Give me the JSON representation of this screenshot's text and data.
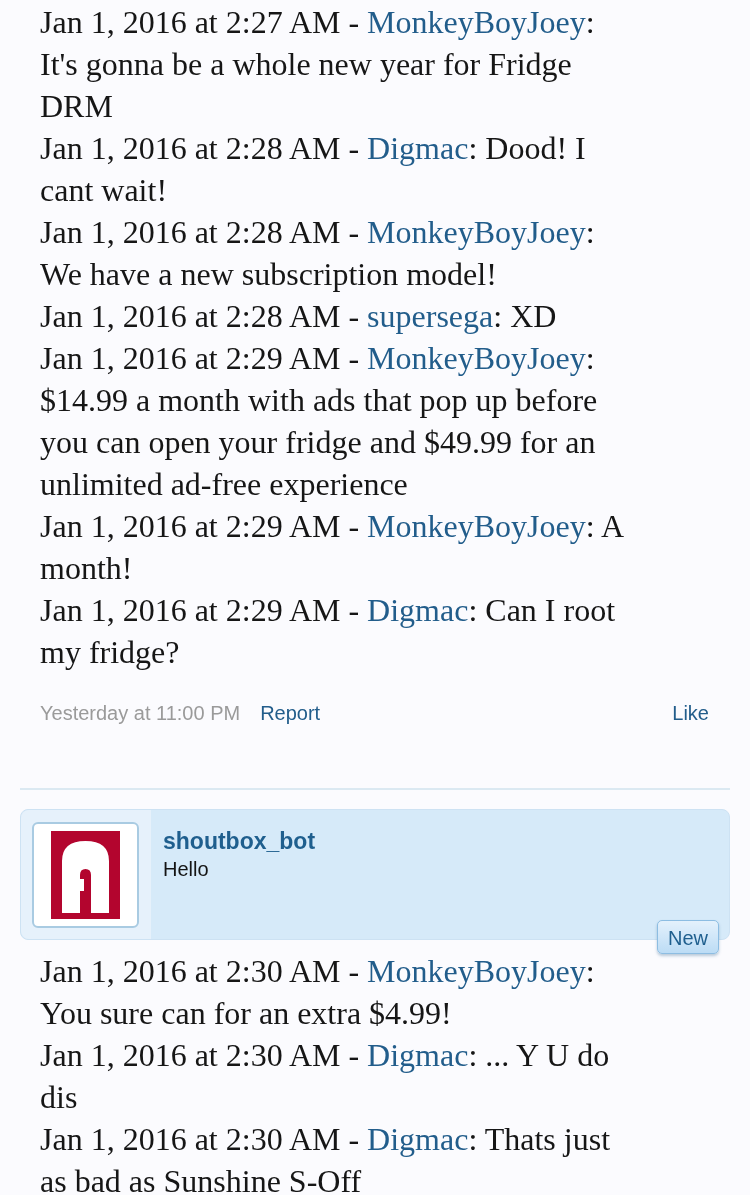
{
  "posts": [
    {
      "messages": [
        {
          "lead": "Jan 1, 2016 at 2:27 AM -",
          "user": "MonkeyBoyJoey",
          "text": ": It's gonna be a whole new year for Fridge DRM"
        },
        {
          "lead": "Jan 1, 2016 at 2:28 AM -",
          "user": "Digmac",
          "text": ": Dood! I cant wait!"
        },
        {
          "lead": "Jan 1, 2016 at 2:28 AM -",
          "user": "MonkeyBoyJoey",
          "text": ": We have a new subscription model!"
        },
        {
          "lead": "Jan 1, 2016 at 2:28 AM -",
          "user": "supersega",
          "text": ": XD"
        },
        {
          "lead": "Jan 1, 2016 at 2:29 AM -",
          "user": "MonkeyBoyJoey",
          "text": ": $14.99 a month with ads that pop up before you can open your fridge and $49.99 for an unlimited ad-free experience"
        },
        {
          "lead": "Jan 1, 2016 at 2:29 AM -",
          "user": "MonkeyBoyJoey",
          "text": ": A month!"
        },
        {
          "lead": "Jan 1, 2016 at 2:29 AM -",
          "user": "Digmac",
          "text": ": Can I root my fridge?"
        }
      ],
      "footer": {
        "date": "Yesterday at 11:00 PM",
        "report": "Report",
        "like": "Like"
      }
    },
    {
      "header": {
        "name": "shoutbox_bot",
        "message": "Hello",
        "badge": "New"
      },
      "messages": [
        {
          "lead": "Jan 1, 2016 at 2:30 AM -",
          "user": "MonkeyBoyJoey",
          "text": ": You sure can for an extra $4.99!"
        },
        {
          "lead": "Jan 1, 2016 at 2:30 AM -",
          "user": "Digmac",
          "text": ": ... Y U do dis"
        },
        {
          "lead": "Jan 1, 2016 at 2:30 AM -",
          "user": "Digmac",
          "text": ": Thats just as bad as Sunshine S-Off"
        }
      ]
    }
  ]
}
